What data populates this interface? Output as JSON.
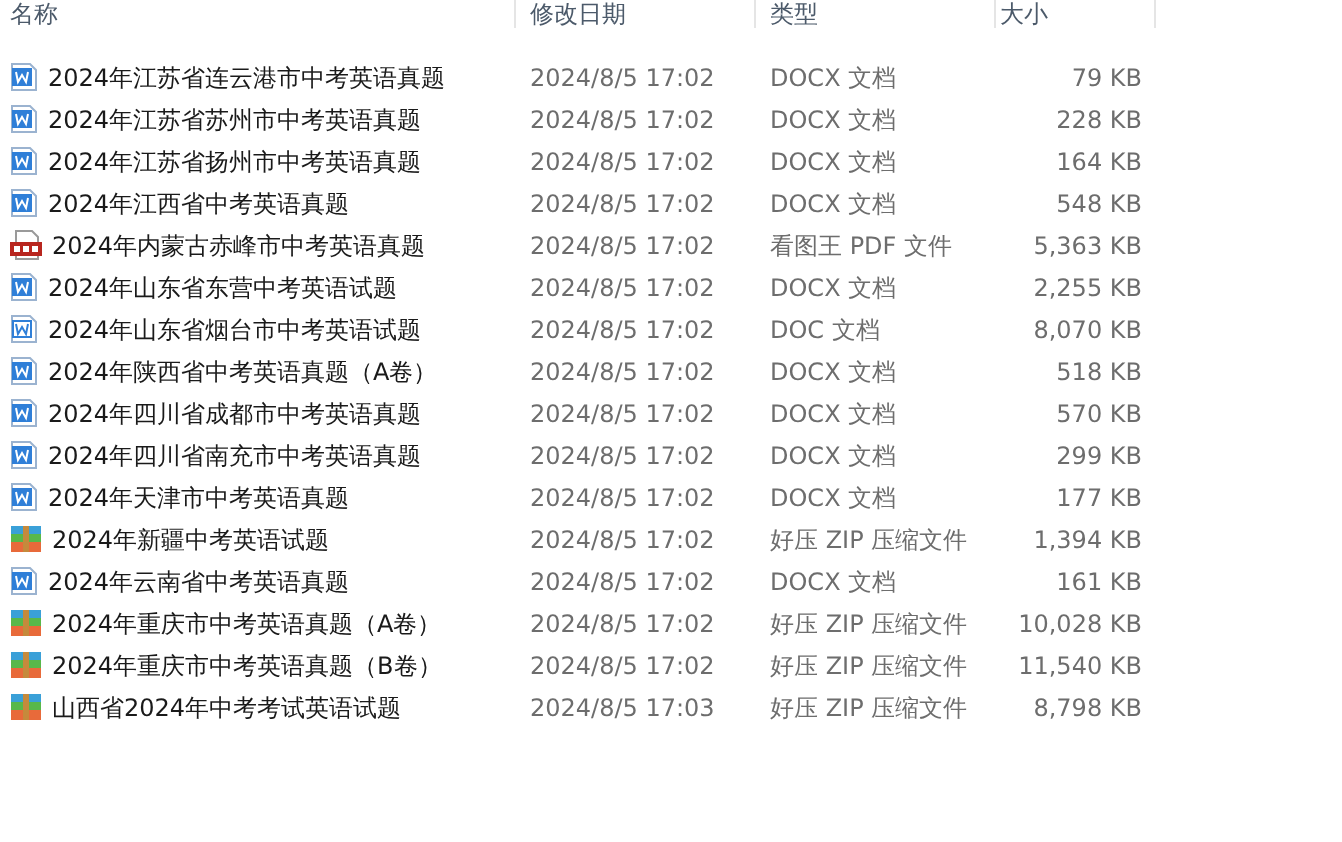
{
  "columns": [
    "名称",
    "修改日期",
    "类型",
    "大小"
  ],
  "rows": [
    {
      "kind": "docx",
      "name": "2024年江苏省连云港市中考英语真题",
      "date": "2024/8/5 17:02",
      "type": "DOCX 文档",
      "size": "79 KB"
    },
    {
      "kind": "docx",
      "name": "2024年江苏省苏州市中考英语真题",
      "date": "2024/8/5 17:02",
      "type": "DOCX 文档",
      "size": "228 KB"
    },
    {
      "kind": "docx",
      "name": "2024年江苏省扬州市中考英语真题",
      "date": "2024/8/5 17:02",
      "type": "DOCX 文档",
      "size": "164 KB"
    },
    {
      "kind": "docx",
      "name": "2024年江西省中考英语真题",
      "date": "2024/8/5 17:02",
      "type": "DOCX 文档",
      "size": "548 KB"
    },
    {
      "kind": "pdf",
      "name": "2024年内蒙古赤峰市中考英语真题",
      "date": "2024/8/5 17:02",
      "type": "看图王 PDF 文件",
      "size": "5,363 KB"
    },
    {
      "kind": "docx",
      "name": "2024年山东省东营中考英语试题",
      "date": "2024/8/5 17:02",
      "type": "DOCX 文档",
      "size": "2,255 KB"
    },
    {
      "kind": "doc",
      "name": "2024年山东省烟台市中考英语试题",
      "date": "2024/8/5 17:02",
      "type": "DOC 文档",
      "size": "8,070 KB"
    },
    {
      "kind": "docx",
      "name": "2024年陕西省中考英语真题（A卷）",
      "date": "2024/8/5 17:02",
      "type": "DOCX 文档",
      "size": "518 KB"
    },
    {
      "kind": "docx",
      "name": "2024年四川省成都市中考英语真题",
      "date": "2024/8/5 17:02",
      "type": "DOCX 文档",
      "size": "570 KB"
    },
    {
      "kind": "docx",
      "name": "2024年四川省南充市中考英语真题",
      "date": "2024/8/5 17:02",
      "type": "DOCX 文档",
      "size": "299 KB"
    },
    {
      "kind": "docx",
      "name": "2024年天津市中考英语真题",
      "date": "2024/8/5 17:02",
      "type": "DOCX 文档",
      "size": "177 KB"
    },
    {
      "kind": "zip",
      "name": "2024年新疆中考英语试题",
      "date": "2024/8/5 17:02",
      "type": "好压 ZIP 压缩文件",
      "size": "1,394 KB"
    },
    {
      "kind": "docx",
      "name": "2024年云南省中考英语真题",
      "date": "2024/8/5 17:02",
      "type": "DOCX 文档",
      "size": "161 KB"
    },
    {
      "kind": "zip",
      "name": "2024年重庆市中考英语真题（A卷）",
      "date": "2024/8/5 17:02",
      "type": "好压 ZIP 压缩文件",
      "size": "10,028 KB"
    },
    {
      "kind": "zip",
      "name": "2024年重庆市中考英语真题（B卷）",
      "date": "2024/8/5 17:02",
      "type": "好压 ZIP 压缩文件",
      "size": "11,540 KB"
    },
    {
      "kind": "zip",
      "name": "山西省2024年中考考试英语试题",
      "date": "2024/8/5 17:03",
      "type": "好压 ZIP 压缩文件",
      "size": "8,798 KB"
    }
  ]
}
